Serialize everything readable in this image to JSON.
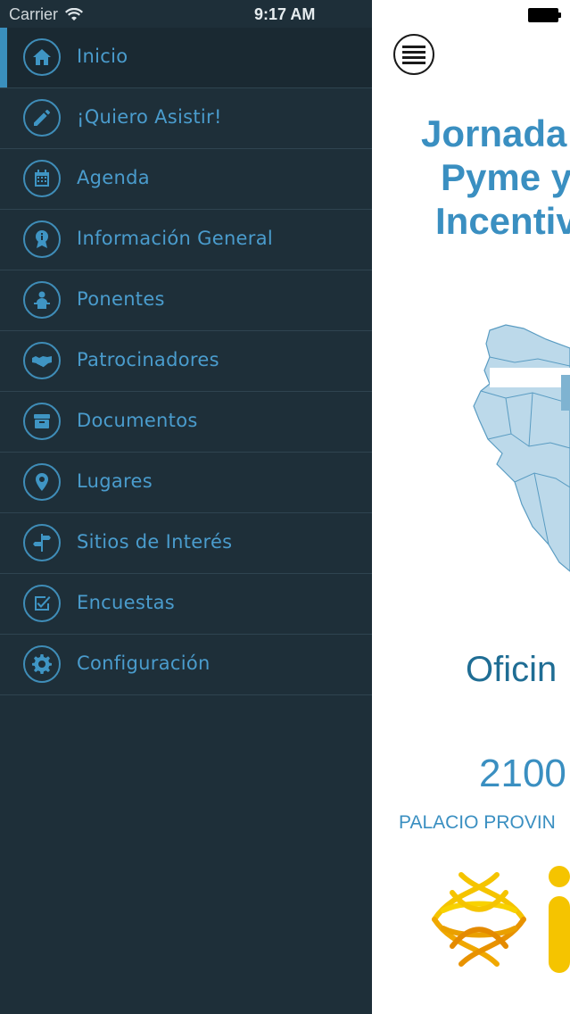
{
  "status_bar": {
    "carrier": "Carrier",
    "time": "9:17 AM"
  },
  "menu": {
    "items": [
      {
        "label": "Inicio",
        "icon": "home-icon"
      },
      {
        "label": "¡Quiero Asistir!",
        "icon": "pencil-icon"
      },
      {
        "label": "Agenda",
        "icon": "calendar-icon"
      },
      {
        "label": "Información General",
        "icon": "info-badge-icon"
      },
      {
        "label": "Ponentes",
        "icon": "speaker-icon"
      },
      {
        "label": "Patrocinadores",
        "icon": "handshake-icon"
      },
      {
        "label": "Documentos",
        "icon": "archive-icon"
      },
      {
        "label": "Lugares",
        "icon": "location-pin-icon"
      },
      {
        "label": "Sitios de Interés",
        "icon": "signpost-icon"
      },
      {
        "label": "Encuestas",
        "icon": "survey-check-icon"
      },
      {
        "label": "Configuración",
        "icon": "gear-icon"
      }
    ],
    "active_index": 0
  },
  "main": {
    "title_line1": "Jornada",
    "title_line2": "Pyme y",
    "title_line3": "Incentiv",
    "subtitle": "Oficin",
    "date": "2100",
    "place": "PALACIO PROVIN"
  },
  "colors": {
    "sidebar_bg": "#1e2f39",
    "accent": "#3a8fbd",
    "menu_text": "#4a9ccd",
    "logo_yellow": "#f5c400"
  }
}
